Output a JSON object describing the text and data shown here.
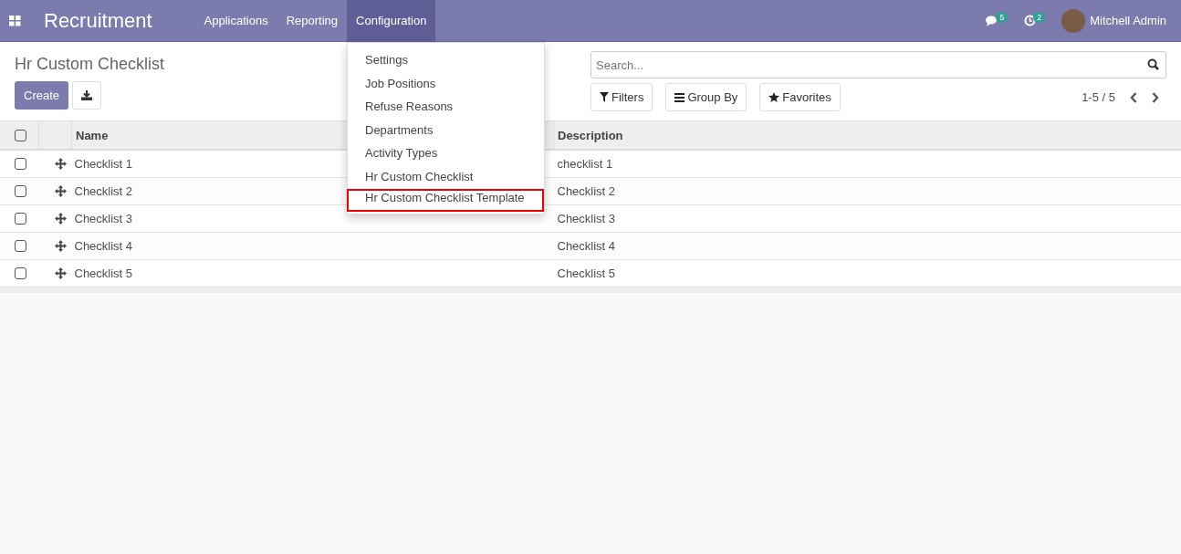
{
  "navbar": {
    "app_title": "Recruitment",
    "menu": [
      {
        "label": "Applications",
        "selected": false
      },
      {
        "label": "Reporting",
        "selected": false
      },
      {
        "label": "Configuration",
        "selected": true
      }
    ],
    "messages_count": "5",
    "activities_count": "2",
    "user": "Mitchell Admin"
  },
  "dropdown": {
    "items": [
      {
        "label": "Settings",
        "highlighted": false
      },
      {
        "label": "Job Positions",
        "highlighted": false
      },
      {
        "label": "Refuse Reasons",
        "highlighted": false
      },
      {
        "label": "Departments",
        "highlighted": false
      },
      {
        "label": "Activity Types",
        "highlighted": false
      },
      {
        "label": "Hr Custom Checklist",
        "highlighted": false
      },
      {
        "label": "Hr Custom Checklist Template",
        "highlighted": true
      }
    ]
  },
  "control_panel": {
    "title": "Hr Custom Checklist",
    "create_button": "Create",
    "search": {
      "placeholder": "Search..."
    },
    "filters": "Filters",
    "group_by": "Group By",
    "favorites": "Favorites",
    "pager": "1-5 / 5"
  },
  "table": {
    "select_all_checked": false,
    "columns": [
      "Name",
      "Description"
    ],
    "rows": [
      {
        "name": "Checklist 1",
        "description": "checklist 1",
        "checked": false
      },
      {
        "name": "Checklist 2",
        "description": "Checklist 2",
        "checked": false
      },
      {
        "name": "Checklist 3",
        "description": "Checklist 3",
        "checked": false
      },
      {
        "name": "Checklist 4",
        "description": "Checklist 4",
        "checked": false
      },
      {
        "name": "Checklist 5",
        "description": "Checklist 5",
        "checked": false
      }
    ]
  }
}
